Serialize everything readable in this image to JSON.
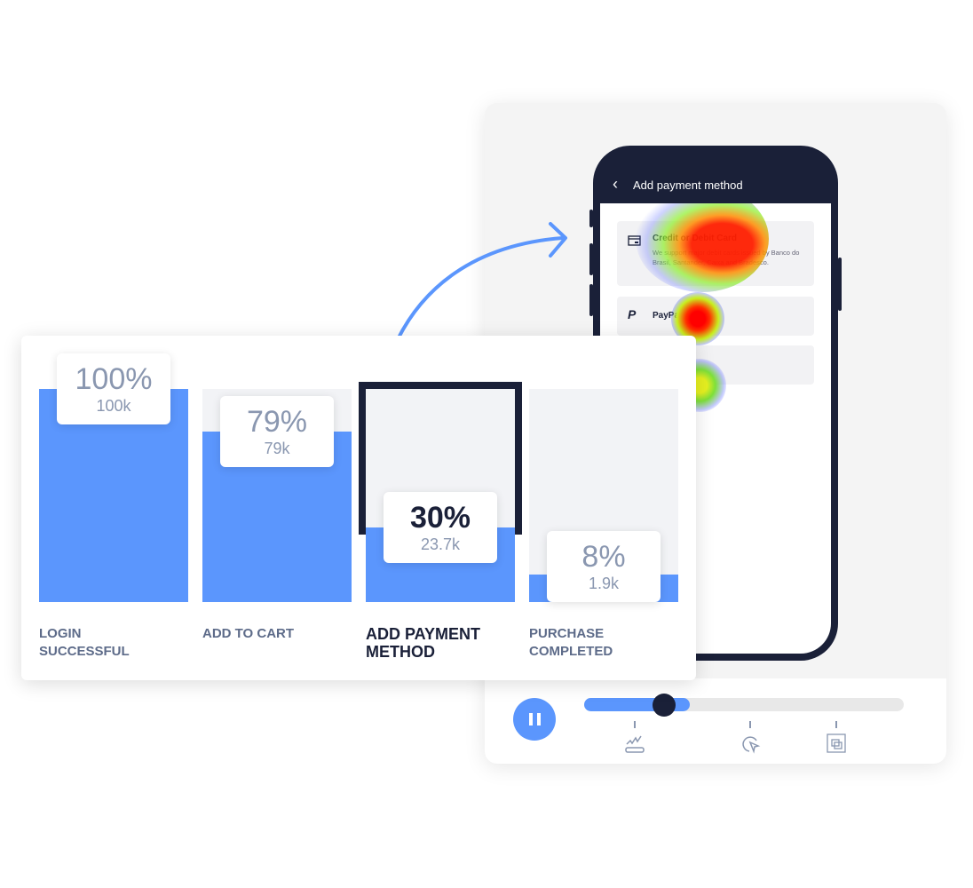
{
  "phone": {
    "title": "Add payment method",
    "options": [
      {
        "title": "Credit or Debit Card",
        "description": "We support major debit cards issued by Banco do Brasil, Santander, Caixa and Bradesco.",
        "icon": "credit-card-icon"
      },
      {
        "title": "PayPal",
        "icon": "paypal-icon"
      },
      {
        "title": ""
      }
    ]
  },
  "player": {
    "state": "playing",
    "progress_buffered": 0.33,
    "progress_position": 0.25,
    "markers": [
      {
        "icon": "scroll-icon"
      },
      {
        "icon": "click-icon"
      },
      {
        "icon": "selection-icon"
      }
    ]
  },
  "funnel": {
    "highlighted": 2,
    "stages": [
      {
        "label": "LOGIN SUCCESSFUL",
        "percent_label": "100%",
        "count": "100k",
        "fill": 1.0
      },
      {
        "label": "ADD TO CART",
        "percent_label": "79%",
        "count": "79k",
        "fill": 0.8
      },
      {
        "label": "ADD PAYMENT METHOD",
        "percent_label": "30%",
        "count": "23.7k",
        "fill": 0.35
      },
      {
        "label": "PURCHASE COMPLETED",
        "percent_label": "8%",
        "count": "1.9k",
        "fill": 0.13
      }
    ]
  },
  "colors": {
    "accent": "#5b96fd",
    "dark": "#1a2038",
    "muted": "#8a97b0"
  }
}
